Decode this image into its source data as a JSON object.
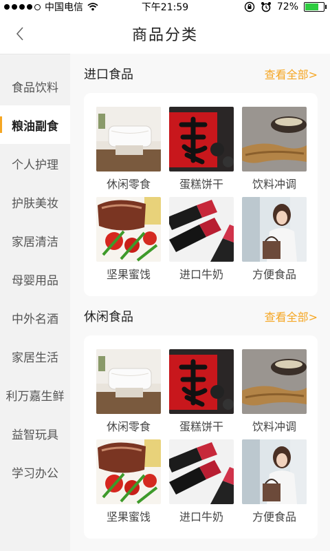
{
  "status_bar": {
    "carrier": "中国电信",
    "time": "下午21:59",
    "battery_percent": "72%",
    "battery_level": 0.72
  },
  "header": {
    "title": "商品分类"
  },
  "sidebar": {
    "items": [
      {
        "label": "食品饮料"
      },
      {
        "label": "粮油副食"
      },
      {
        "label": "个人护理"
      },
      {
        "label": "护肤美妆"
      },
      {
        "label": "家居清洁"
      },
      {
        "label": "母婴用品"
      },
      {
        "label": "中外名酒"
      },
      {
        "label": "家居生活"
      },
      {
        "label": "利万嘉生鲜"
      },
      {
        "label": "益智玩具"
      },
      {
        "label": "学习办公"
      }
    ],
    "active_index": 1
  },
  "sections": [
    {
      "title": "进口食品",
      "view_all": "查看全部>",
      "items": [
        {
          "label": "休闲零食",
          "image": "pillow-photo"
        },
        {
          "label": "蛋糕饼干",
          "image": "fu-calligraphy-photo"
        },
        {
          "label": "饮料冲调",
          "image": "ginseng-photo"
        },
        {
          "label": "坚果蜜饯",
          "image": "roast-meat-photo"
        },
        {
          "label": "进口牛奶",
          "image": "lipstick-photo"
        },
        {
          "label": "方便食品",
          "image": "woman-shopping-photo"
        }
      ]
    },
    {
      "title": "休闲食品",
      "view_all": "查看全部>",
      "items": [
        {
          "label": "休闲零食",
          "image": "pillow-photo"
        },
        {
          "label": "蛋糕饼干",
          "image": "fu-calligraphy-photo"
        },
        {
          "label": "饮料冲调",
          "image": "ginseng-photo"
        },
        {
          "label": "坚果蜜饯",
          "image": "roast-meat-photo"
        },
        {
          "label": "进口牛奶",
          "image": "lipstick-photo"
        },
        {
          "label": "方便食品",
          "image": "woman-shopping-photo"
        }
      ]
    }
  ],
  "colors": {
    "accent": "#f5a623",
    "battery_green": "#2ecc40"
  }
}
